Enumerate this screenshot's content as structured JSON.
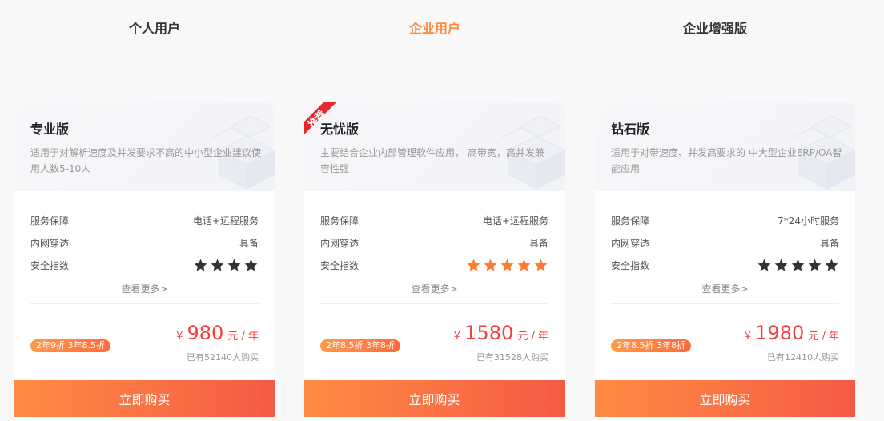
{
  "tabs": [
    {
      "label": "个人用户",
      "active": false
    },
    {
      "label": "企业用户",
      "active": true
    },
    {
      "label": "企业增强版",
      "active": false
    }
  ],
  "accent_color": "#ff8a3d",
  "price_color": "#f23f3f",
  "feature_labels": {
    "service": "服务保障",
    "intranet": "内网穿透",
    "security": "安全指数"
  },
  "cards": [
    {
      "title": "专业版",
      "desc": "适用于对解析速度及并发要求不高的中小型企业建议使用人数5-10人",
      "recommended": false,
      "service": "电话+远程服务",
      "intranet": "具备",
      "security_stars": 4,
      "star_color": "#333333",
      "more": "查看更多>",
      "discount": "2年9折 3年8.5折",
      "currency": "¥",
      "price": "980",
      "unit": "元 / 年",
      "sold": "已有52140人购买",
      "buy_label": "立即购买"
    },
    {
      "title": "无忧版",
      "desc": "主要结合企业内部管理软件应用， 高带宽，高并发兼容性强",
      "recommended": true,
      "ribbon_text": "推荐",
      "service": "电话+远程服务",
      "intranet": "具备",
      "security_stars": 5,
      "star_color": "#ff7a2f",
      "more": "查看更多>",
      "discount": "2年8.5折 3年8折",
      "currency": "¥",
      "price": "1580",
      "unit": "元 / 年",
      "sold": "已有31528人购买",
      "buy_label": "立即购买"
    },
    {
      "title": "钻石版",
      "desc": "适用于对带速度、并发高要求的 中大型企业ERP/OA智能应用",
      "recommended": false,
      "service": "7*24小时服务",
      "intranet": "具备",
      "security_stars": 5,
      "star_color": "#333333",
      "more": "查看更多>",
      "discount": "2年8.5折 3年8折",
      "currency": "¥",
      "price": "1980",
      "unit": "元 / 年",
      "sold": "已有12410人购买",
      "buy_label": "立即购买"
    }
  ]
}
